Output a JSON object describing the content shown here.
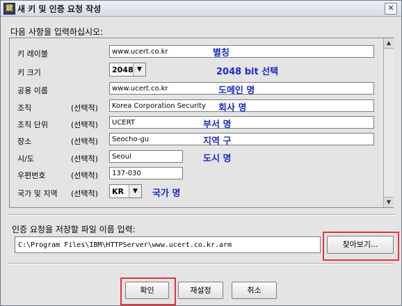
{
  "window": {
    "title": "새 키 및 인증 요청 작성",
    "icon": "app-icon",
    "close_symbol": "✕"
  },
  "instruction": "다음 사항을 입력하십시오:",
  "fields": {
    "key_name": {
      "label": "키 레이블",
      "value": "www.ucert.co.kr",
      "annotation": "별칭"
    },
    "key_size": {
      "label": "키 크기",
      "value": "2048",
      "annotation": "2048 bit 선택"
    },
    "common_name": {
      "label": "공용 이름",
      "value": "www.ucert.co.kr",
      "annotation": "도메인 명"
    },
    "organization": {
      "label": "조직",
      "optional": "(선택적)",
      "value": "Korea Corporation Security",
      "annotation": "회사 명"
    },
    "org_unit": {
      "label": "조직 단위",
      "optional": "(선택적)",
      "value": "UCERT",
      "annotation": "부서 명"
    },
    "locality": {
      "label": "장소",
      "optional": "(선택적)",
      "value": "Seocho-gu",
      "annotation": "지역 구"
    },
    "state": {
      "label": "시/도",
      "optional": "(선택적)",
      "value": "Seoul",
      "annotation": "도시 명"
    },
    "postal": {
      "label": "우편번호",
      "optional": "(선택적)",
      "value": "137-030"
    },
    "country": {
      "label": "국가 및 지역",
      "optional": "(선택적)",
      "value": "KR",
      "annotation": "국가 명"
    }
  },
  "file": {
    "label": "인증 요청을 저장할 파일 이름 입력:",
    "path": "C:\\Program Files\\IBM\\HTTPServer\\www.ucert.co.kr.arm",
    "browse_label": "찾아보기..."
  },
  "buttons": {
    "ok": "확인",
    "reset": "재설정",
    "cancel": "취소"
  },
  "highlight_color": "#e8323a",
  "annotation_color": "#1a2bc8"
}
